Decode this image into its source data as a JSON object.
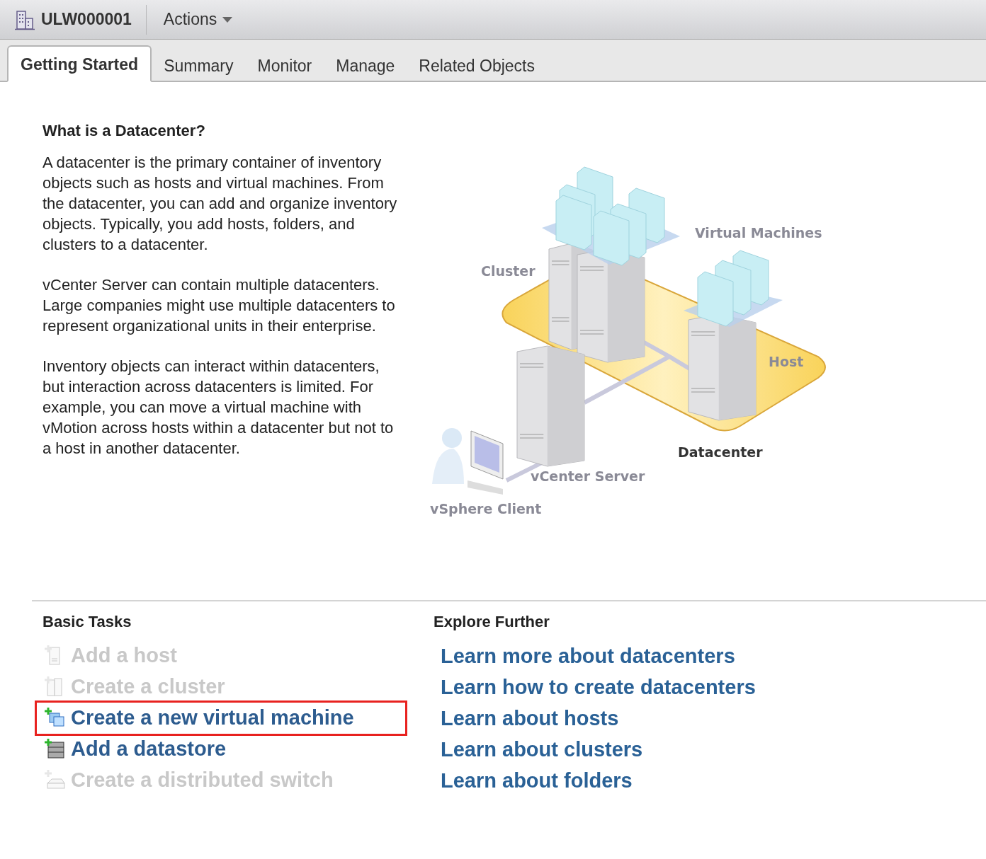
{
  "header": {
    "title": "ULW000001",
    "actions": "Actions"
  },
  "tabs": [
    {
      "label": "Getting Started",
      "selected": true
    },
    {
      "label": "Summary",
      "selected": false
    },
    {
      "label": "Monitor",
      "selected": false
    },
    {
      "label": "Manage",
      "selected": false
    },
    {
      "label": "Related Objects",
      "selected": false
    }
  ],
  "intro": {
    "heading": "What is a Datacenter?",
    "paragraphs": [
      "A datacenter is the primary container of inventory objects such as hosts and virtual machines. From the datacenter, you can add and organize inventory objects. Typically, you add hosts, folders, and clusters to a datacenter.",
      "vCenter Server can contain multiple datacenters. Large companies might use multiple datacenters to represent organizational units in their enterprise.",
      "Inventory objects can interact within datacenters, but interaction across datacenters is limited. For example, you can move a virtual machine with vMotion across hosts within a datacenter but not to a host in another datacenter."
    ]
  },
  "diagram": {
    "labels": [
      {
        "kind": "vms",
        "text": "Virtual Machines"
      },
      {
        "kind": "cluster",
        "text": "Cluster"
      },
      {
        "kind": "host",
        "text": "Host"
      },
      {
        "kind": "datacenter",
        "text": "Datacenter"
      },
      {
        "kind": "vcenter",
        "text": "vCenter Server"
      },
      {
        "kind": "client",
        "text": "vSphere Client"
      }
    ]
  },
  "basic_tasks": {
    "heading": "Basic Tasks",
    "items": [
      {
        "kind": "host",
        "label": "Add a host",
        "disabled": true,
        "highlighted": false
      },
      {
        "kind": "cluster",
        "label": "Create a cluster",
        "disabled": true,
        "highlighted": false
      },
      {
        "kind": "vm",
        "label": "Create a new virtual machine",
        "disabled": false,
        "highlighted": true
      },
      {
        "kind": "datastore",
        "label": "Add a datastore",
        "disabled": false,
        "highlighted": false
      },
      {
        "kind": "switch",
        "label": "Create a distributed switch",
        "disabled": true,
        "highlighted": false
      }
    ]
  },
  "explore_further": {
    "heading": "Explore Further",
    "links": [
      "Learn more about datacenters",
      "Learn how to create datacenters",
      "Learn about hosts",
      "Learn about clusters",
      "Learn about folders"
    ]
  }
}
